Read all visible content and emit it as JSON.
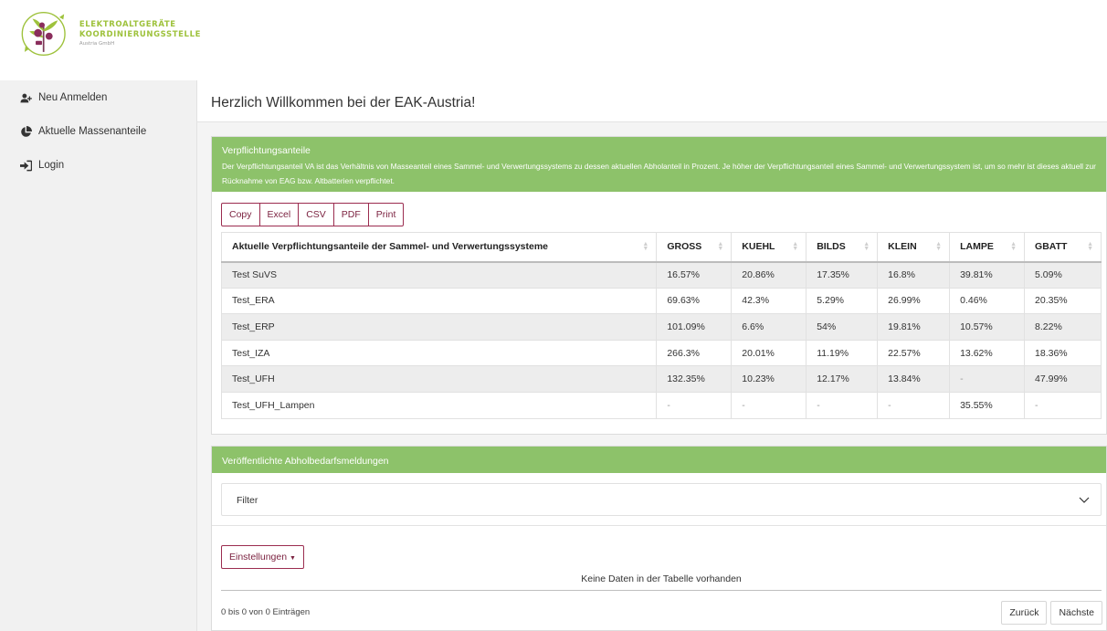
{
  "brand": {
    "line1": "ELEKTROALTGERÄTE",
    "line2": "KOORDINIERUNGSSTELLE",
    "line3": "Austria GmbH",
    "accent_green": "#9ec23c",
    "logo_icon": "recycling-plant-logo"
  },
  "sidebar": {
    "items": [
      {
        "label": "Neu Anmelden",
        "icon": "user-plus-icon"
      },
      {
        "label": "Aktuelle Massenanteile",
        "icon": "pie-chart-icon"
      },
      {
        "label": "Login",
        "icon": "sign-in-icon"
      }
    ]
  },
  "page": {
    "title": "Herzlich Willkommen bei der EAK-Austria!"
  },
  "obligations": {
    "title": "Verpflichtungsanteile",
    "description": "Der Verpflichtungsanteil VA ist das Verhältnis von Masseanteil eines Sammel- und Verwertungssystems zu dessen aktuellen Abholanteil in Prozent. Je höher der Verpflichtungsanteil eines Sammel- und Verwertungssystem ist, um so mehr ist dieses aktuell zur Rücknahme von EAG bzw. Altbatterien verpflichtet.",
    "header_color": "#8dc26a",
    "export_buttons": [
      "Copy",
      "Excel",
      "CSV",
      "PDF",
      "Print"
    ],
    "columns": [
      "Aktuelle Verpflichtungsanteile der Sammel- und Verwertungssysteme",
      "GROSS",
      "KUEHL",
      "BILDS",
      "KLEIN",
      "LAMPE",
      "GBATT"
    ],
    "rows": [
      [
        "Test SuVS",
        "16.57%",
        "20.86%",
        "17.35%",
        "16.8%",
        "39.81%",
        "5.09%"
      ],
      [
        "Test_ERA",
        "69.63%",
        "42.3%",
        "5.29%",
        "26.99%",
        "0.46%",
        "20.35%"
      ],
      [
        "Test_ERP",
        "101.09%",
        "6.6%",
        "54%",
        "19.81%",
        "10.57%",
        "8.22%"
      ],
      [
        "Test_IZA",
        "266.3%",
        "20.01%",
        "11.19%",
        "22.57%",
        "13.62%",
        "18.36%"
      ],
      [
        "Test_UFH",
        "132.35%",
        "10.23%",
        "12.17%",
        "13.84%",
        "-",
        "47.99%"
      ],
      [
        "Test_UFH_Lampen",
        "-",
        "-",
        "-",
        "-",
        "35.55%",
        "-"
      ]
    ]
  },
  "pickups": {
    "title": "Veröffentlichte Abholbedarfsmeldungen",
    "filter_label": "Filter",
    "settings_label": "Einstellungen",
    "empty_message": "Keine Daten in der Tabelle vorhanden",
    "info": "0 bis 0 von 0 Einträgen",
    "prev_label": "Zurück",
    "next_label": "Nächste",
    "button_color": "#9b2c4f"
  }
}
